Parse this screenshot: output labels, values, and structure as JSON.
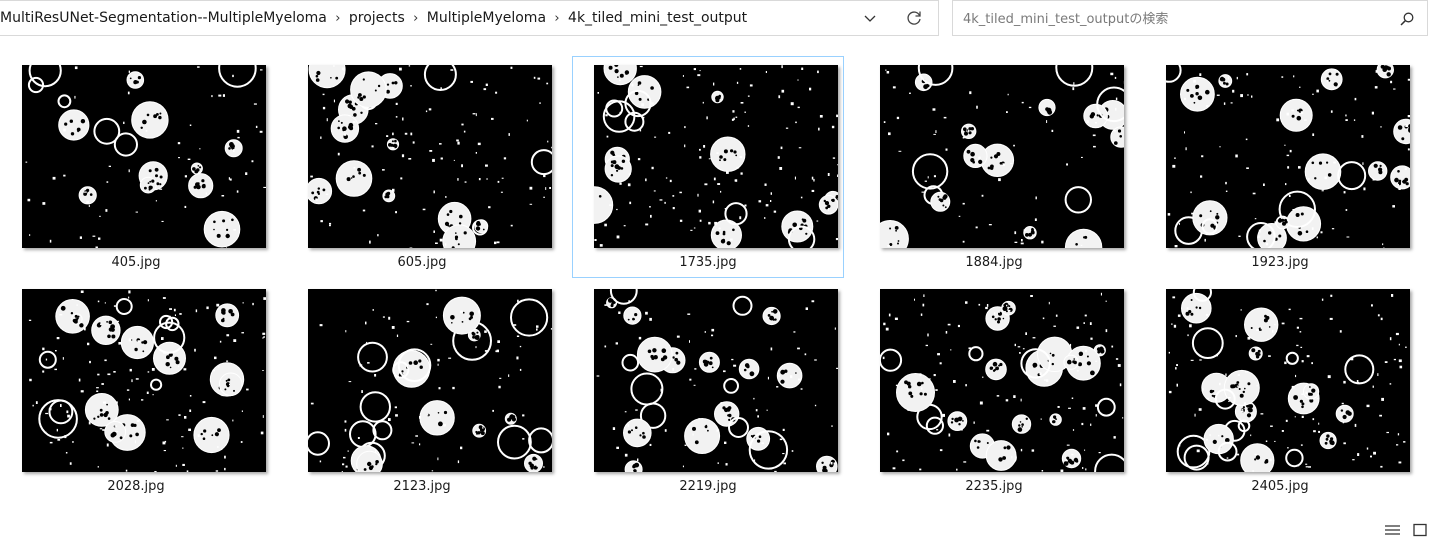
{
  "address_bar": {
    "crumbs": [
      "MultiResUNet-Segmentation--MultipleMyeloma",
      "projects",
      "MultipleMyeloma",
      "4k_tiled_mini_test_output"
    ],
    "separator": "›",
    "dropdown_icon": "chevron-down-icon",
    "refresh_icon": "refresh-icon"
  },
  "search": {
    "placeholder": "4k_tiled_mini_test_outputの検索",
    "icon": "search-icon"
  },
  "files": [
    {
      "name": "405.jpg"
    },
    {
      "name": "605.jpg"
    },
    {
      "name": "1735.jpg",
      "selected": true
    },
    {
      "name": "1884.jpg"
    },
    {
      "name": "1923.jpg"
    },
    {
      "name": "2028.jpg"
    },
    {
      "name": "2123.jpg"
    },
    {
      "name": "2219.jpg"
    },
    {
      "name": "2235.jpg"
    },
    {
      "name": "2405.jpg"
    }
  ],
  "view_controls": {
    "details_icon": "details-view-icon",
    "tiles_icon": "large-icons-view-icon"
  },
  "colors": {
    "selection_border": "#99d1ff",
    "border": "#d9d9d9"
  }
}
